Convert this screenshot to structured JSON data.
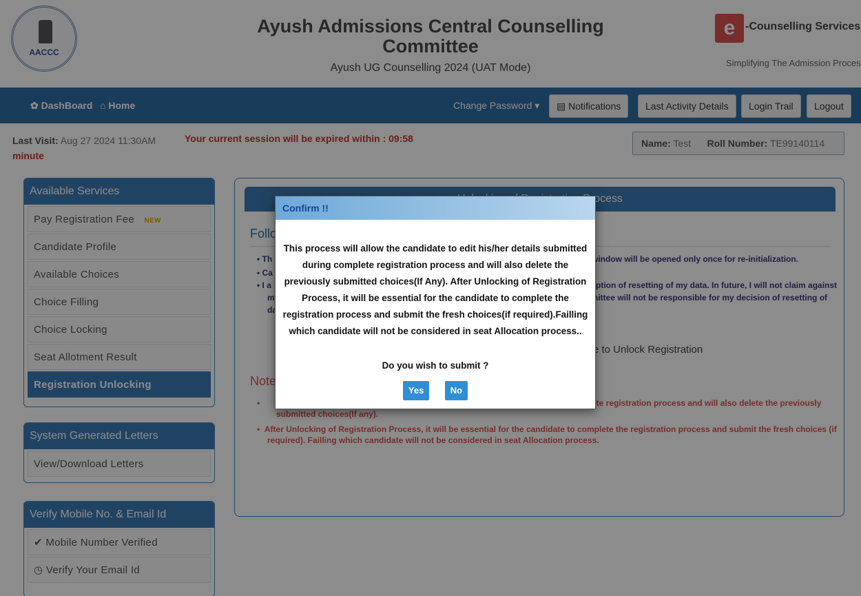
{
  "header": {
    "logo_text": "AACCC",
    "title": "Ayush Admissions Central Counselling Committee",
    "subtitle": "Ayush UG Counselling 2024 (UAT Mode)",
    "brand_letter": "e",
    "brand_name": "-Counselling Services",
    "brand_tagline": "Simplifying The Admission Process"
  },
  "navbar": {
    "dashboard": " DashBoard",
    "home": " Home",
    "change_password": "Change Password ▾",
    "notifications": "▤ Notifications",
    "last_activity": "Last Activity Details",
    "login_trail": "Login Trail",
    "logout": "Logout"
  },
  "info": {
    "last_visit_label": "Last Visit:",
    "last_visit_value": " Aug 27 2024 11:30AM",
    "minute": "minute",
    "session": "Your current session will be expired within : 09:58",
    "name_label": "Name:",
    "name_value": " Test",
    "roll_label": "Roll Number:",
    "roll_value": " TE99140114"
  },
  "sidebar": {
    "services_title": "Available Services",
    "services": [
      "Pay Registration Fee",
      "Candidate Profile",
      "Available Choices",
      "Choice Filling",
      "Choice Locking",
      "Seat Allotment Result",
      "Registration Unlocking"
    ],
    "new_badge": "NEW",
    "letters_title": "System Generated Letters",
    "letters_item": "View/Download Letters",
    "verify_title": "Verify Mobile No. & Email Id",
    "verify_mobile": "✔ Mobile Number Verified",
    "verify_email": "◷ Verify Your Email Id"
  },
  "main": {
    "heading": "Unlocking of Registration Process",
    "follow": "Follo",
    "line1_prefix": "Th",
    "line1_suffix": "window will be opened only once for re-initialization.",
    "line2_prefix": "Ca",
    "line3_prefix": "I a",
    "line3_suffix": "ption of resetting of my data. In future, I will not claim against",
    "line4_prefix": "my",
    "line4_suffix": "nittee will not be responsible for my decision of resetting of",
    "line5_prefix": "da",
    "unlock_text": "e to Unlock Registration",
    "note": "Note",
    "note1_suffix": "ete registration process and will also delete the previously",
    "note1_cont": "submitted choices(If any).",
    "note2": "After Unlocking of Registration Process, it will be essential for the candidate to complete the registration process and submit the fresh choices (if",
    "note2_cont": "required). Failling which candidate will not be considered in seat Allocation process."
  },
  "modal": {
    "title": "Confirm !!",
    "body": "This process will allow the candidate to edit his/her details submitted during complete registration process and will also delete the previously submitted choices(If Any). After Unlocking of Registration Process, it will be essential for the candidate to complete the registration process and submit the fresh choices(if required).Failling which candidate will not be considered in seat Allocation process..",
    "question": "Do you wish to submit ?",
    "yes": "Yes",
    "no": "No"
  },
  "colors": {
    "primary": "#2e6da4",
    "panel": "#3d7bb4",
    "danger": "#d9534f",
    "button": "#2f8fd6"
  }
}
